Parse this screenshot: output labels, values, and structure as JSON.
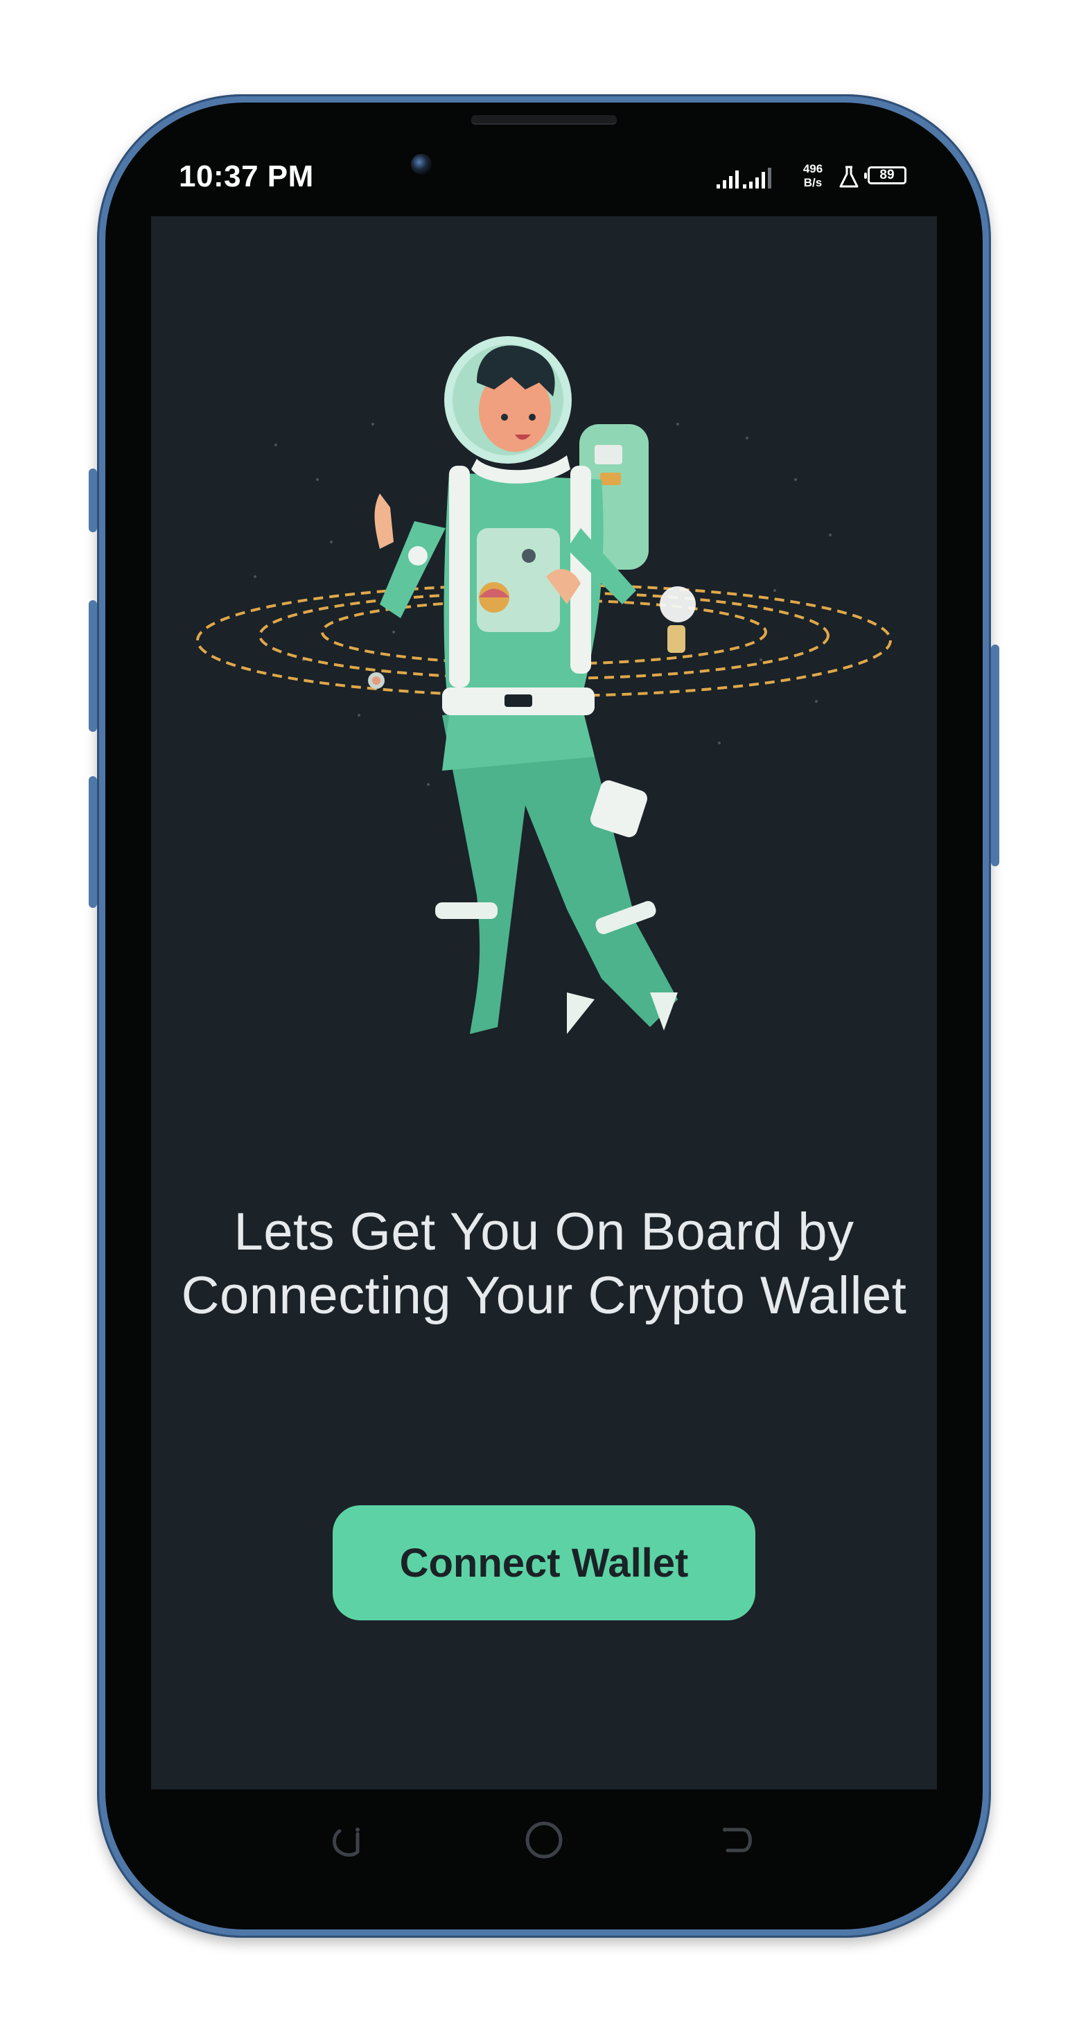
{
  "status_bar": {
    "time": "10:37 PM",
    "net_speed_value": "496",
    "net_speed_unit": "B/s",
    "battery_level": "89"
  },
  "onboarding": {
    "headline_line1": "Lets Get You On Board by",
    "headline_line2": "Connecting Your Crypto Wallet",
    "illustration": "astronaut-icon"
  },
  "actions": {
    "connect_wallet_label": "Connect Wallet"
  },
  "navigation": {
    "back_icon": "back-icon",
    "home_icon": "home-icon",
    "recents_icon": "recents-icon"
  },
  "colors": {
    "screen_background": "#1b2228",
    "accent": "#5dd3a5",
    "orbit": "#e0a84a",
    "phone_frame": "#4f78a8"
  }
}
